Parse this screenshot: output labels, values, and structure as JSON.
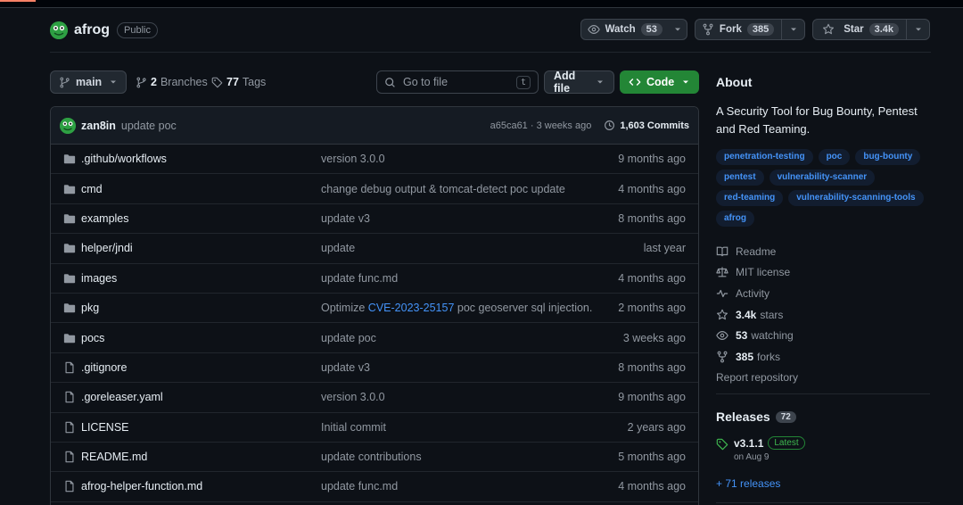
{
  "repo": {
    "name": "afrog",
    "visibility": "Public"
  },
  "actions": {
    "watch": {
      "label": "Watch",
      "count": "53"
    },
    "fork": {
      "label": "Fork",
      "count": "385"
    },
    "star": {
      "label": "Star",
      "count": "3.4k"
    }
  },
  "toolbar": {
    "branch": "main",
    "branches_count": "2",
    "branches_label": "Branches",
    "tags_count": "77",
    "tags_label": "Tags",
    "goto_placeholder": "Go to file",
    "goto_key": "t",
    "add_file": "Add file",
    "code": "Code"
  },
  "commit": {
    "author": "zan8in",
    "message": "update poc",
    "meta": "a65ca61 · 3 weeks ago",
    "commits": "1,603 Commits"
  },
  "files": [
    {
      "type": "dir",
      "name": ".github/workflows",
      "msg": "version 3.0.0",
      "time": "9 months ago"
    },
    {
      "type": "dir",
      "name": "cmd",
      "msg": "change debug output & tomcat-detect poc update",
      "time": "4 months ago"
    },
    {
      "type": "dir",
      "name": "examples",
      "msg": "update v3",
      "time": "8 months ago"
    },
    {
      "type": "dir",
      "name": "helper/jndi",
      "msg": "update",
      "time": "last year"
    },
    {
      "type": "dir",
      "name": "images",
      "msg": "update func.md",
      "time": "4 months ago"
    },
    {
      "type": "dir",
      "name": "pkg",
      "msg_pre": "Optimize ",
      "msg_link": "CVE-2023-25157",
      "msg_post": " poc geoserver sql injection.",
      "time": "2 months ago"
    },
    {
      "type": "dir",
      "name": "pocs",
      "msg": "update poc",
      "time": "3 weeks ago"
    },
    {
      "type": "file",
      "name": ".gitignore",
      "msg": "update v3",
      "time": "8 months ago"
    },
    {
      "type": "file",
      "name": ".goreleaser.yaml",
      "msg": "version 3.0.0",
      "time": "9 months ago"
    },
    {
      "type": "file",
      "name": "LICENSE",
      "msg": "Initial commit",
      "time": "2 years ago"
    },
    {
      "type": "file",
      "name": "README.md",
      "msg": "update contributions",
      "time": "5 months ago"
    },
    {
      "type": "file",
      "name": "afrog-helper-function.md",
      "msg": "update func.md",
      "time": "4 months ago"
    }
  ],
  "about": {
    "title": "About",
    "description": "A Security Tool for Bug Bounty, Pentest and Red Teaming.",
    "topics": [
      "penetration-testing",
      "poc",
      "bug-bounty",
      "pentest",
      "vulnerability-scanner",
      "red-teaming",
      "vulnerability-scanning-tools",
      "afrog"
    ],
    "links": {
      "readme": "Readme",
      "license": "MIT license",
      "activity": "Activity",
      "stars_num": "3.4k",
      "stars_label": "stars",
      "watching_num": "53",
      "watching_label": "watching",
      "forks_num": "385",
      "forks_label": "forks",
      "report": "Report repository"
    }
  },
  "releases": {
    "title": "Releases",
    "count": "72",
    "latest_version": "v3.1.1",
    "latest_badge": "Latest",
    "latest_date": "on Aug 9",
    "more": "+ 71 releases"
  },
  "colors": {
    "background": "#0d1117",
    "accent_blue": "#4493f8",
    "green": "#238636"
  }
}
